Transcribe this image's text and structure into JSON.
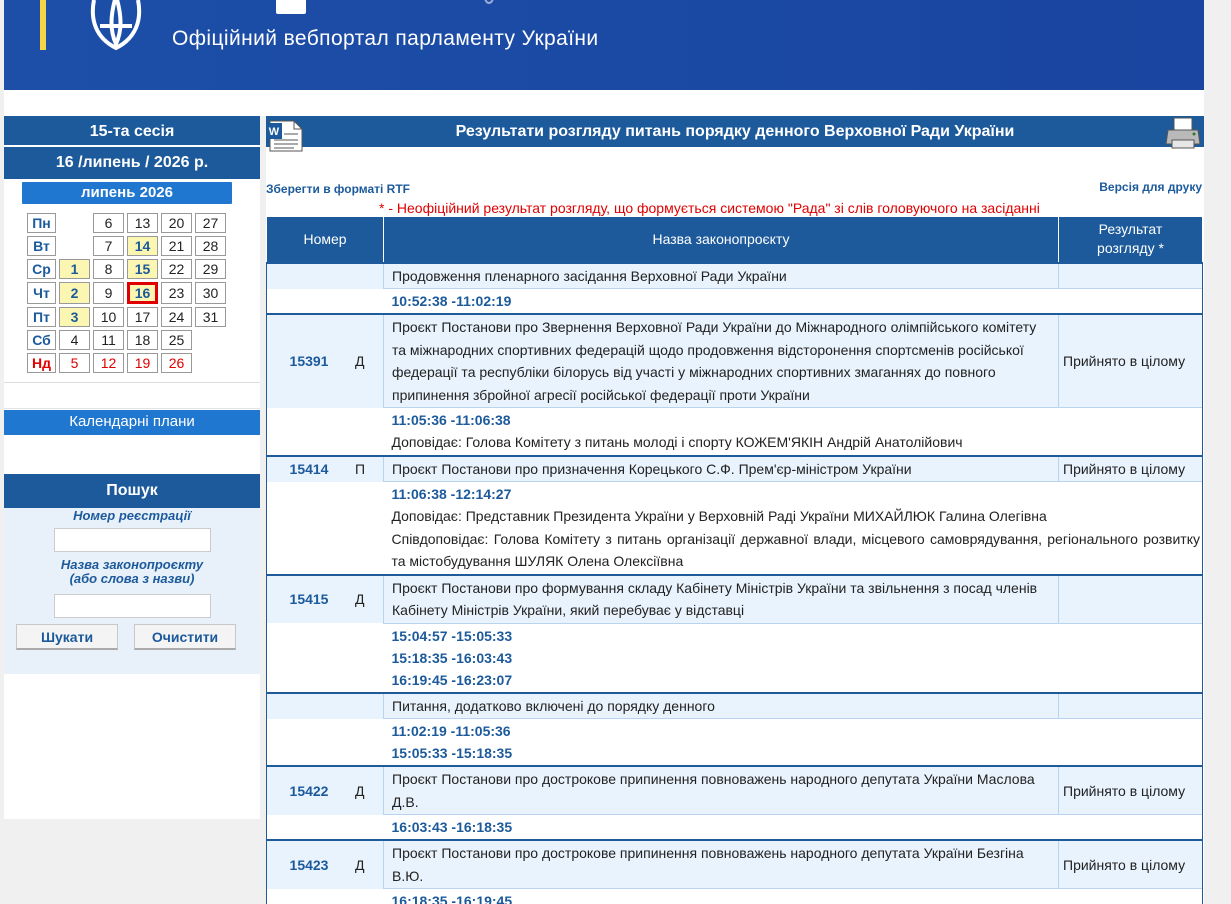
{
  "header": {
    "subtitle": "Офіційний вебпортал парламенту України"
  },
  "left": {
    "session": "15-та сесія",
    "current_date": "16 /липень / 2026 р.",
    "month": "липень 2026",
    "calendar": [
      {
        "day": "Пн",
        "cells": [
          "",
          "6",
          "13",
          "20",
          "27"
        ],
        "hl": [],
        "sun": false
      },
      {
        "day": "Вт",
        "cells": [
          "",
          "7",
          "14",
          "21",
          "28"
        ],
        "hl": [
          2
        ],
        "sun": false
      },
      {
        "day": "Ср",
        "cells": [
          "1",
          "8",
          "15",
          "22",
          "29"
        ],
        "hl": [
          0,
          2
        ],
        "sun": false
      },
      {
        "day": "Чт",
        "cells": [
          "2",
          "9",
          "16",
          "23",
          "30"
        ],
        "hl": [
          0,
          2
        ],
        "cur": 2,
        "sun": false
      },
      {
        "day": "Пт",
        "cells": [
          "3",
          "10",
          "17",
          "24",
          "31"
        ],
        "hl": [
          0
        ],
        "sun": false
      },
      {
        "day": "Сб",
        "cells": [
          "4",
          "11",
          "18",
          "25",
          ""
        ],
        "hl": [],
        "sun": false
      },
      {
        "day": "Нд",
        "cells": [
          "5",
          "12",
          "19",
          "26",
          ""
        ],
        "hl": [],
        "sun": true
      }
    ],
    "calendar_plans": "Календарні плани",
    "search": {
      "title": "Пошук",
      "reg_label": "Номер реєстрації",
      "name_label_1": "Назва законопроєкту",
      "name_label_2": "(або слова з назви)",
      "search_btn": "Шукати",
      "clear_btn": "Очистити"
    }
  },
  "main": {
    "title": "Результати розгляду питань порядку денного Верховної Ради України",
    "save_rtf": "Зберегти в форматі RTF",
    "print_version": "Версія для друку",
    "note": "* - Неофіційний результат розгляду, що формується системою \"Рада\" зі слів головуючого на засіданні",
    "columns": {
      "num": "Номер",
      "name": "Назва законопроєкту",
      "res1": "Результат",
      "res2": "розгляду *"
    },
    "rows": [
      {
        "num": "",
        "type": "",
        "name": "Продовження пленарного засідання Верховної Ради України",
        "result": "",
        "times": [
          "10:52:38 -11:02:19"
        ],
        "reports": []
      },
      {
        "num": "15391",
        "type": "Д",
        "name": "Проєкт Постанови про Звернення Верховної Ради України до Міжнародного олімпійського комітету та міжнародних спортивних федерацій щодо продовження відсторонення спортсменів російської федерації та республіки білорусь від участі у міжнародних спортивних змаганнях до повного припинення збройної агресії російської федерації проти України",
        "result": "Прийнято в цілому",
        "times": [
          "11:05:36 -11:06:38"
        ],
        "reports": [
          "Доповідає: Голова Комітету з питань молоді і спорту КОЖЕМ'ЯКІН Андрій Анатолійович"
        ]
      },
      {
        "num": "15414",
        "type": "П",
        "name": "Проєкт Постанови про призначення Корецького С.Ф. Прем'єр-міністром України",
        "result": "Прийнято в цілому",
        "times": [
          "11:06:38 -12:14:27"
        ],
        "reports": [
          "Доповідає: Представник Президента України у Верховній Раді України МИХАЙЛЮК Галина Олегівна",
          "Співдоповідає: Голова Комітету з питань організації державної влади, місцевого самоврядування, регіонального розвитку та містобудування ШУЛЯК Олена Олексіївна"
        ]
      },
      {
        "num": "15415",
        "type": "Д",
        "name": "Проєкт Постанови про формування складу Кабінету Міністрів України та звільнення з посад членів Кабінету Міністрів України, який перебуває у відставці",
        "result": "",
        "times": [
          "15:04:57 -15:05:33",
          "15:18:35 -16:03:43",
          "16:19:45 -16:23:07"
        ],
        "reports": []
      },
      {
        "num": "",
        "type": "",
        "name": "Питання, додатково включені до порядку денного",
        "result": "",
        "times": [
          "11:02:19 -11:05:36",
          "15:05:33 -15:18:35"
        ],
        "reports": []
      },
      {
        "num": "15422",
        "type": "Д",
        "name": "Проєкт Постанови про дострокове припинення повноважень народного депутата України Маслова Д.В.",
        "result": "Прийнято в цілому",
        "times": [
          "16:03:43 -16:18:35"
        ],
        "reports": []
      },
      {
        "num": "15423",
        "type": "Д",
        "name": "Проєкт Постанови про дострокове припинення повноважень народного депутата України Безгіна В.Ю.",
        "result": "Прийнято в цілому",
        "times": [
          "16:18:35 -16:19:45"
        ],
        "reports": []
      }
    ]
  }
}
